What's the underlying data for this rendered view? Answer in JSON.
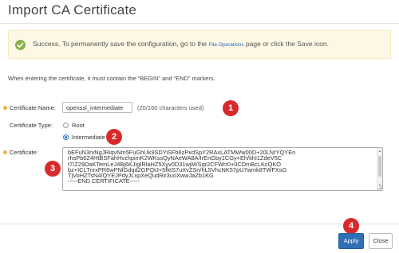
{
  "dialog": {
    "title": "Import CA Certificate"
  },
  "alert": {
    "text_before": "Success. To permanently save the configuration, go to the ",
    "link": "File Operations",
    "text_after": " page or click the Save icon."
  },
  "hint": "When entering the certificate, it must contain the “BEGIN” and “END” markers.",
  "form": {
    "name_label": "Certificate Name:",
    "name_value": "openssl_intermediate",
    "char_count": "(20/160 characters used)",
    "type_label": "Certificate Type:",
    "type_options": [
      {
        "label": "Root",
        "selected": false
      },
      {
        "label": "Intermediate",
        "selected": true
      }
    ],
    "cert_label": "Certificate:",
    "cert_lines": [
      "bEFuN3rvNgJRiqvNm5FuGhUk9SDYiSFb6zPxdSpY2RAxLATMWw00D+20LNrYQYEn",
      "rhsPb6Z4HtBSFahHvzhpimK2WKssQyNAeWA8A/IrEnGby1CGy+Eh/khI1ZdeV5C",
      "t7/Z29DaKTemLeJ4Bj6KJigIRlaHZ5Xyv0D31wjM/Sqr2CFWrr0+0CDmBcLKcQKO",
      "bz+ICLTnrxPR6wPNlGdqd2GPQtJ+5fktS7uXvZSn/hL5VhcNK57pU7wmk8TWFXsG",
      "TjVoHZTsN4/QYEJPdyJLxpXeQudRir3uoXwwJaZb1KG",
      "-----END CERTIFICATE-----"
    ]
  },
  "badges": [
    "1",
    "2",
    "3",
    "4"
  ],
  "buttons": {
    "apply": "Apply",
    "close": "Close"
  },
  "colors": {
    "badge": "#d82a2a",
    "primary": "#2f6fb5",
    "alert_bg": "#fcf8e3",
    "success_icon": "#8ab34b",
    "required_dot": "#f0ad4e"
  }
}
